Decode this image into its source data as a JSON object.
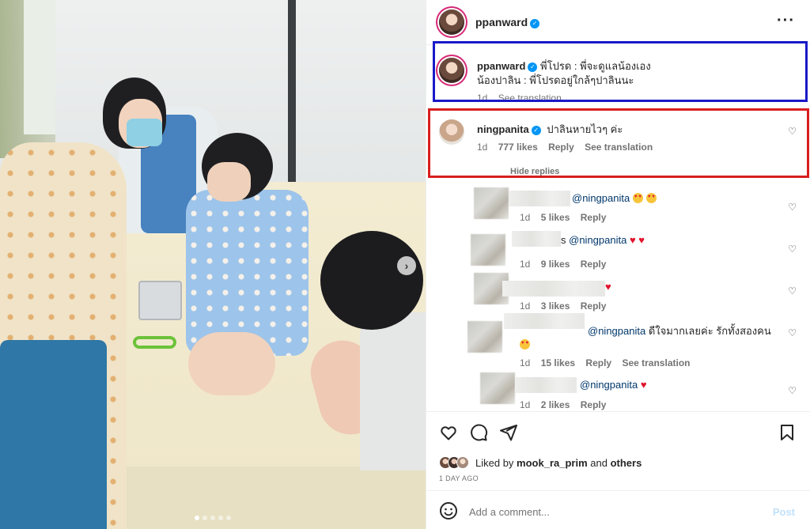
{
  "post": {
    "username": "ppanward",
    "more_icon": "ellipsis-icon"
  },
  "caption": {
    "username": "ppanward",
    "line1": "พี่โปรด : พี่จะดูแลน้องเอง",
    "line2": "น้องปาลิน : พี่โปรดอยู่ใกล้ๆปาลินนะ",
    "time": "1d",
    "see_translation": "See translation"
  },
  "top_comment": {
    "username": "ningpanita",
    "text": "ปาลินหายไวๆ ค่ะ",
    "time": "1d",
    "likes": "777 likes",
    "reply": "Reply",
    "see_translation": "See translation",
    "hide_replies": "Hide replies"
  },
  "replies": [
    {
      "name_suffix": "",
      "mention": "@ningpanita",
      "text": "",
      "time": "1d",
      "likes": "5 likes",
      "reply": "Reply",
      "see_translation": ""
    },
    {
      "name_suffix": "s",
      "mention": "@ningpanita",
      "text": "",
      "time": "1d",
      "likes": "9 likes",
      "reply": "Reply",
      "see_translation": ""
    },
    {
      "name_suffix": "",
      "mention": "",
      "text": "",
      "time": "1d",
      "likes": "3 likes",
      "reply": "Reply",
      "see_translation": ""
    },
    {
      "name_suffix": "",
      "mention": "@ningpanita",
      "text": "ดีใจมากเลยค่ะ รักทั้งสองคน",
      "time": "1d",
      "likes": "15 likes",
      "reply": "Reply",
      "see_translation": "See translation"
    },
    {
      "name_suffix": "",
      "mention": "@ningpanita",
      "text": "",
      "time": "1d",
      "likes": "2 likes",
      "reply": "Reply",
      "see_translation": ""
    }
  ],
  "actions": {
    "like_icon": "heart-icon",
    "comment_icon": "comment-icon",
    "share_icon": "send-icon",
    "save_icon": "bookmark-icon",
    "liked_by_prefix": "Liked by",
    "liked_by_user": "mook_ra_prim",
    "liked_by_and": "and",
    "liked_by_others": "others",
    "date": "1 DAY AGO"
  },
  "add_comment": {
    "placeholder": "Add a comment...",
    "post_label": "Post",
    "emoji_icon": "smiley-icon"
  },
  "carousel": {
    "pages": 5,
    "active": 0
  },
  "colors": {
    "verified": "#0095f6",
    "highlight_blue": "#1919c8",
    "highlight_red": "#d81e1e",
    "mention": "#00376b",
    "post_disabled": "#c1e1fb"
  }
}
